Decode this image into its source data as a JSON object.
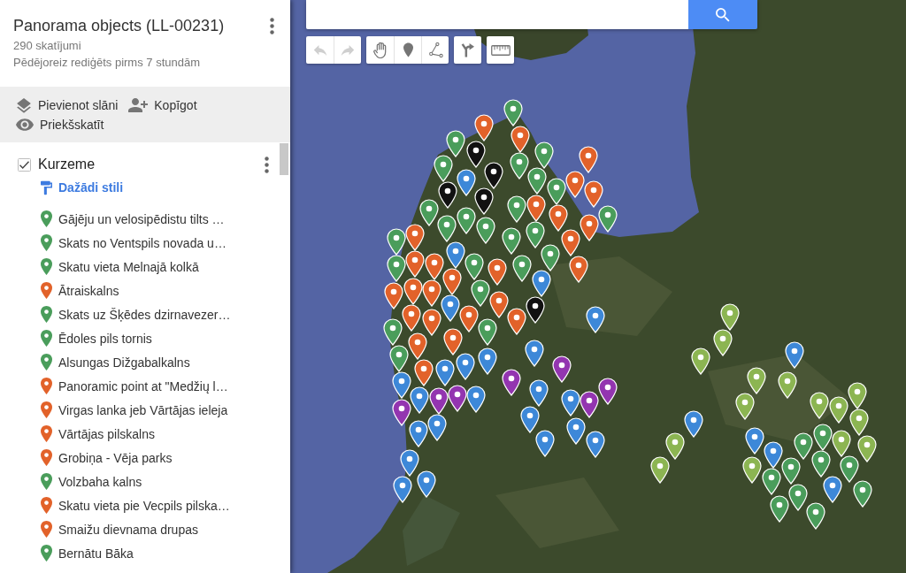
{
  "sidebar": {
    "title": "Panorama objects (LL-00231)",
    "views": "290 skatījumi",
    "edited": "Pēdējoreiz rediģēts pirms 7 stundām",
    "actions": [
      {
        "kind": "add-layer",
        "label": "Pievienot slāni"
      },
      {
        "kind": "share",
        "label": "Kopīgot"
      },
      {
        "kind": "preview",
        "label": "Priekšskatīt"
      }
    ],
    "layer": {
      "name": "Kurzeme",
      "checked": true,
      "style_link": "Dažādi stili",
      "items": [
        {
          "label": "Gājēju un velosipēdistu tilts …",
          "color": "#4a9d5b"
        },
        {
          "label": "Skats no Ventspils novada u…",
          "color": "#4a9d5b"
        },
        {
          "label": "Skatu vieta Melnajā kolkā",
          "color": "#4a9d5b"
        },
        {
          "label": "Ātraiskalns",
          "color": "#e2622a"
        },
        {
          "label": "Skats uz Šķēdes dzirnavezer…",
          "color": "#4a9d5b"
        },
        {
          "label": "Ēdoles pils tornis",
          "color": "#4a9d5b"
        },
        {
          "label": "Alsungas Dižgabalkalns",
          "color": "#4a9d5b"
        },
        {
          "label": "Panoramic point at \"Medžių l…",
          "color": "#e2622a"
        },
        {
          "label": "Virgas lanka jeb Vārtājas ieleja",
          "color": "#e2622a"
        },
        {
          "label": "Vārtājas pilskalns",
          "color": "#e2622a"
        },
        {
          "label": "Grobiņa - Vēja parks",
          "color": "#e2622a"
        },
        {
          "label": "Volzbaha kalns",
          "color": "#4a9d5b"
        },
        {
          "label": "Skatu vieta pie Vecpils pilska…",
          "color": "#e2622a"
        },
        {
          "label": "Smaižu dievnama drupas",
          "color": "#e2622a"
        },
        {
          "label": "Bernātu Bāka",
          "color": "#4a9d5b"
        }
      ]
    }
  },
  "map": {
    "toolbar": [
      {
        "buttons": [
          {
            "kind": "undo",
            "disabled": true
          },
          {
            "kind": "redo",
            "disabled": true
          }
        ]
      },
      {
        "buttons": [
          {
            "kind": "pan",
            "disabled": false
          },
          {
            "kind": "marker",
            "disabled": false
          },
          {
            "kind": "line",
            "disabled": false
          }
        ]
      },
      {
        "buttons": [
          {
            "kind": "directions",
            "disabled": false
          }
        ]
      },
      {
        "buttons": [
          {
            "kind": "ruler",
            "disabled": false
          }
        ]
      }
    ],
    "marker_groups": [
      {
        "color": "#e2622a"
      },
      {
        "color": "#4a9d5b"
      },
      {
        "color": "#111111"
      },
      {
        "color": "#3d88d8"
      },
      {
        "color": "#9335b0"
      },
      {
        "color": "#8cb552"
      }
    ]
  }
}
